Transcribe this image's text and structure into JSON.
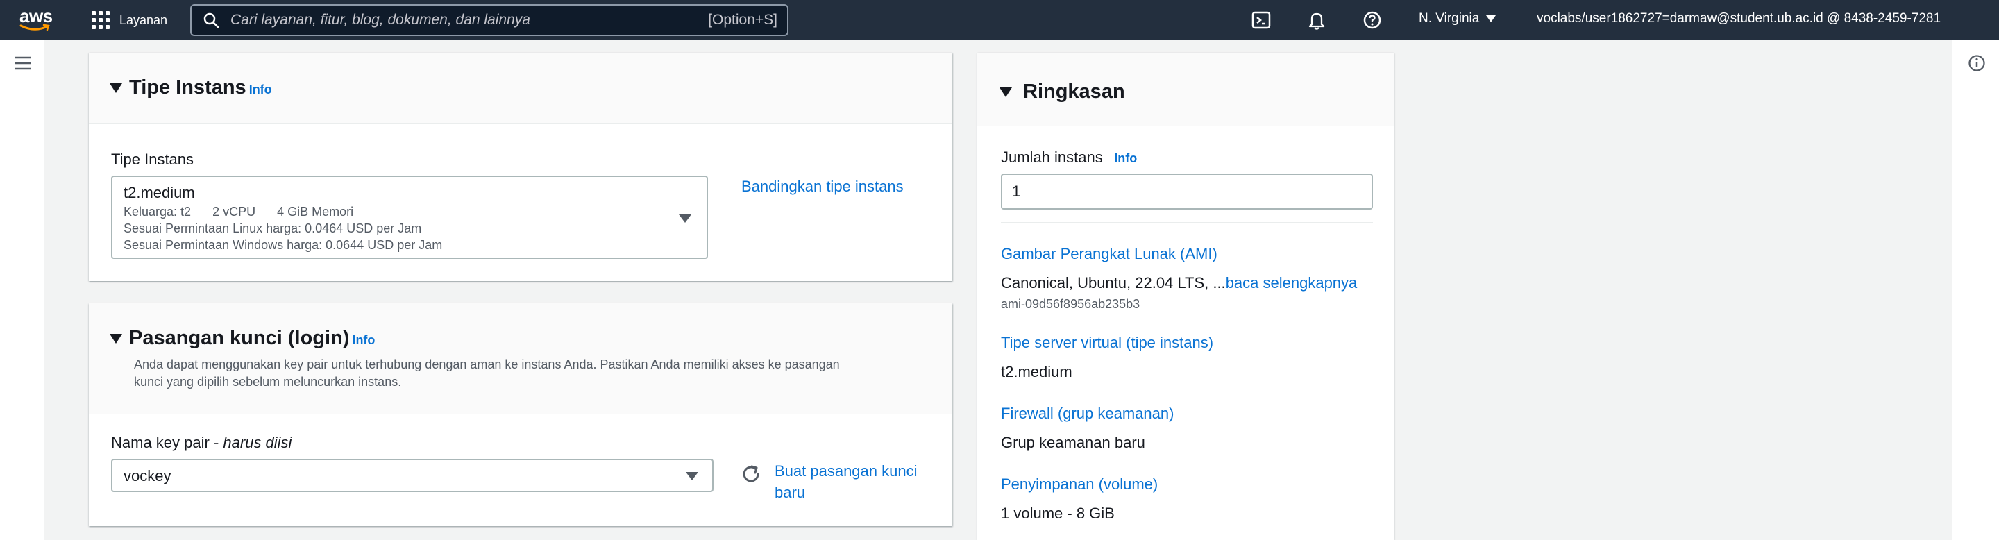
{
  "nav": {
    "brand": "aws",
    "services_label": "Layanan",
    "search_placeholder": "Cari layanan, fitur, blog, dokumen, dan lainnya",
    "search_shortcut": "[Option+S]",
    "region": "N. Virginia",
    "account": "voclabs/user1862727=darmaw@student.ub.ac.id @ 8438-2459-7281"
  },
  "instance_type": {
    "title": "Tipe Instans",
    "info": "Info",
    "field_label": "Tipe Instans",
    "selected": "t2.medium",
    "family": "Keluarga: t2",
    "vcpu": "2 vCPU",
    "memory": "4 GiB Memori",
    "linux_price": "Sesuai Permintaan Linux harga: 0.0464 USD per Jam",
    "windows_price": "Sesuai Permintaan Windows harga: 0.0644 USD per Jam",
    "compare_link": "Bandingkan tipe instans"
  },
  "key_pair": {
    "title": "Pasangan kunci (login)",
    "info": "Info",
    "description_line1": "Anda dapat menggunakan key pair untuk terhubung dengan aman ke instans Anda. Pastikan Anda memiliki akses ke pasangan",
    "description_line2": "kunci yang dipilih sebelum meluncurkan instans.",
    "field_label": "Nama key pair",
    "field_required": "harus diisi",
    "selected": "vockey",
    "create_link_line1": "Buat pasangan kunci",
    "create_link_line2": "baru"
  },
  "summary": {
    "title": "Ringkasan",
    "instances_label": "Jumlah instans",
    "info": "Info",
    "instances_value": "1",
    "ami_label": "Gambar Perangkat Lunak (AMI)",
    "ami_value": "Canonical, Ubuntu, 22.04 LTS, ...",
    "ami_read_more": "baca selengkapnya",
    "ami_id": "ami-09d56f8956ab235b3",
    "server_type_label": "Tipe server virtual (tipe instans)",
    "server_type_value": "t2.medium",
    "firewall_label": "Firewall (grup keamanan)",
    "firewall_value": "Grup keamanan baru",
    "storage_label": "Penyimpanan (volume)",
    "storage_value": "1 volume - 8 GiB"
  }
}
